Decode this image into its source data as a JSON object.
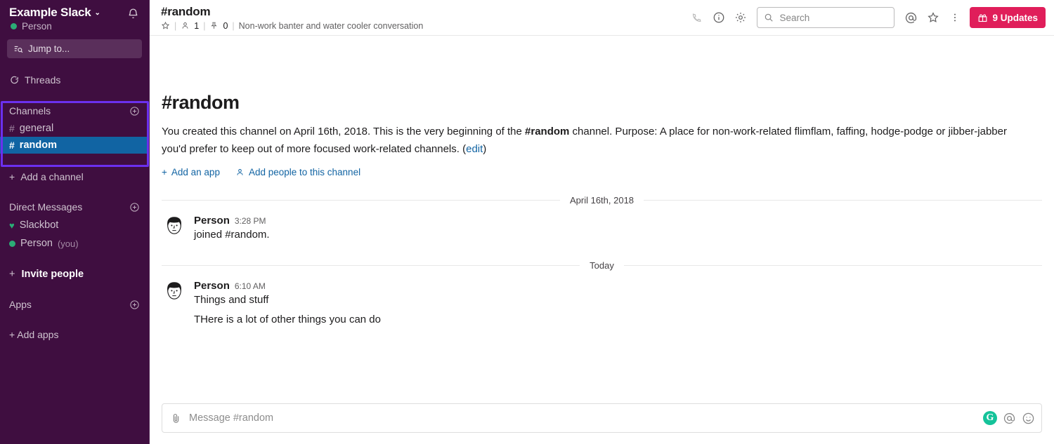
{
  "sidebar": {
    "team_name": "Example Slack",
    "chevron": "⌄",
    "bell_icon": "bell-icon",
    "presence_name": "Person",
    "jump_to": "Jump to...",
    "threads": "Threads",
    "channels_section": {
      "title": "Channels",
      "add_icon": "plus-circle-icon",
      "items": [
        {
          "name": "general",
          "selected": false
        },
        {
          "name": "random",
          "selected": true
        }
      ]
    },
    "add_channel": "Add a channel",
    "dm_section": {
      "title": "Direct Messages",
      "add_icon": "plus-circle-icon",
      "items": [
        {
          "name": "Slackbot",
          "suffix": "",
          "status": "heart"
        },
        {
          "name": "Person",
          "suffix": "(you)",
          "status": "online"
        }
      ]
    },
    "invite_people": "Invite people",
    "apps_section": {
      "title": "Apps",
      "add_icon": "plus-circle-icon"
    },
    "add_apps": "+ Add apps"
  },
  "annotation": {
    "label": "channels-highlight-box",
    "color": "#6B30EE"
  },
  "header": {
    "channel_title": "#random",
    "star_icon": "star-icon",
    "member_count": "1",
    "pin_count": "0",
    "topic": "Non-work banter and water cooler conversation",
    "call_icon": "phone-icon",
    "info_icon": "info-icon",
    "settings_icon": "gear-icon",
    "search_placeholder": "Search",
    "search_value": "",
    "mention_icon": "at-icon",
    "favorite_icon": "star-icon",
    "more_icon": "kebab-menu-icon",
    "updates_label": "9 Updates",
    "updates_icon": "gift-icon",
    "updates_color": "#E01E5A"
  },
  "intro": {
    "heading": "#random",
    "text_part1": "You created this channel on April 16th, 2018. This is the very beginning of the ",
    "channel_bold": "#random",
    "text_part2": " channel. Purpose: A place for non-work-related flimflam, faffing, hodge-podge or jibber-jabber you'd prefer to keep out of more focused work-related channels. (",
    "edit_link": "edit",
    "text_part3": ")",
    "add_app": "Add an app",
    "add_people": "Add people to this channel"
  },
  "conversation": {
    "dividers": {
      "first": "April 16th, 2018",
      "second": "Today"
    },
    "messages": [
      {
        "author": "Person",
        "time": "3:28 PM",
        "text": "joined #random.",
        "extra": ""
      },
      {
        "author": "Person",
        "time": "6:10 AM",
        "text": "Things and stuff",
        "extra": "THere is a lot of other things you can do"
      }
    ]
  },
  "composer": {
    "attach_icon": "paperclip-icon",
    "placeholder": "Message #random",
    "value": "",
    "grammarly_icon": "G",
    "mention_icon": "at-icon",
    "emoji_icon": "emoji-icon"
  }
}
